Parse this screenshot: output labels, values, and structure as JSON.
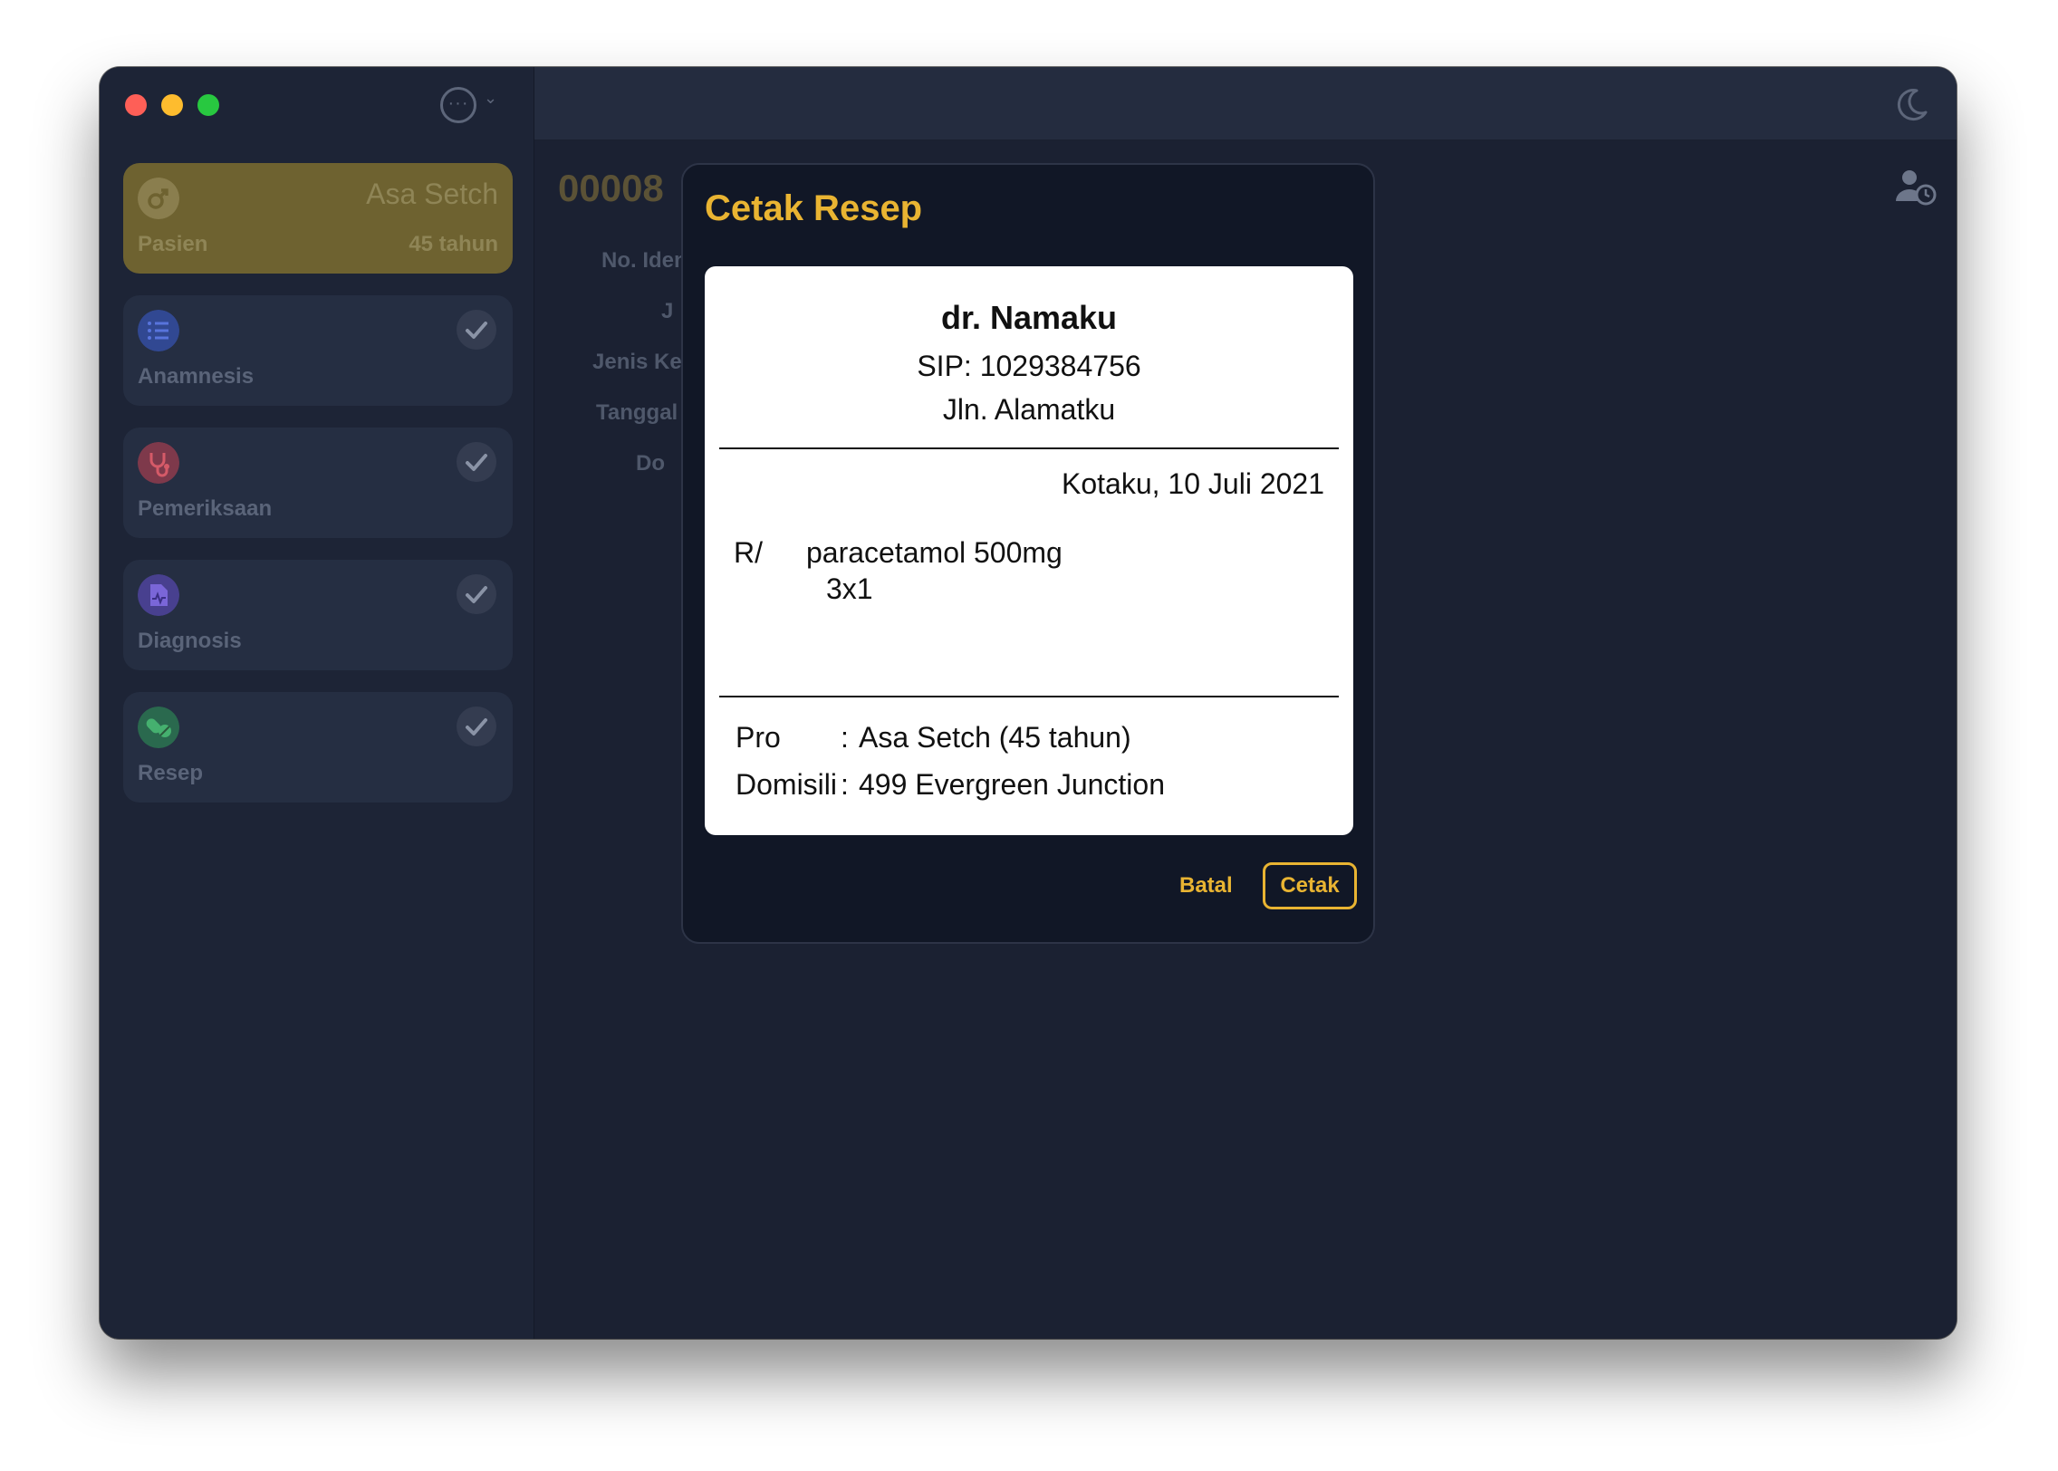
{
  "colors": {
    "accent": "#e9b432",
    "window_bg": "#1c2233",
    "sidebar_bg": "#1d2436",
    "card_bg": "#252e42",
    "card_active_bg": "#6e6230",
    "modal_bg": "#111726",
    "paper_bg": "#ffffff"
  },
  "sidebar": {
    "patient": {
      "label": "Pasien",
      "name": "Asa Setch",
      "age": "45 tahun",
      "icon": "male-icon"
    },
    "steps": [
      {
        "label": "Anamnesis",
        "icon": "checklist-icon",
        "icon_color": "#3d5fd6",
        "done": true
      },
      {
        "label": "Pemeriksaan",
        "icon": "stethoscope-icon",
        "icon_color": "#c94454",
        "done": true
      },
      {
        "label": "Diagnosis",
        "icon": "medical-file-icon",
        "icon_color": "#6650d0",
        "done": true
      },
      {
        "label": "Resep",
        "icon": "pills-icon",
        "icon_color": "#2f9a5a",
        "done": true
      }
    ]
  },
  "background": {
    "record_id": "00008",
    "fields": [
      "No. Iden",
      "J",
      "Jenis Ke",
      "Tanggal",
      "Do"
    ]
  },
  "modal": {
    "title": "Cetak Resep",
    "prescription": {
      "doctor_name": "dr. Namaku",
      "sip": "SIP: 1029384756",
      "address": "Jln. Alamatku",
      "place_date": "Kotaku, 10 Juli 2021",
      "rx_mark": "R/",
      "drug": "paracetamol 500mg",
      "dosage": "3x1",
      "patient_label": "Pro",
      "patient_value": "Asa Setch (45 tahun)",
      "domicile_label": "Domisili",
      "domicile_value": "499 Evergreen Junction",
      "separator": ":"
    },
    "cancel_label": "Batal",
    "print_label": "Cetak"
  }
}
